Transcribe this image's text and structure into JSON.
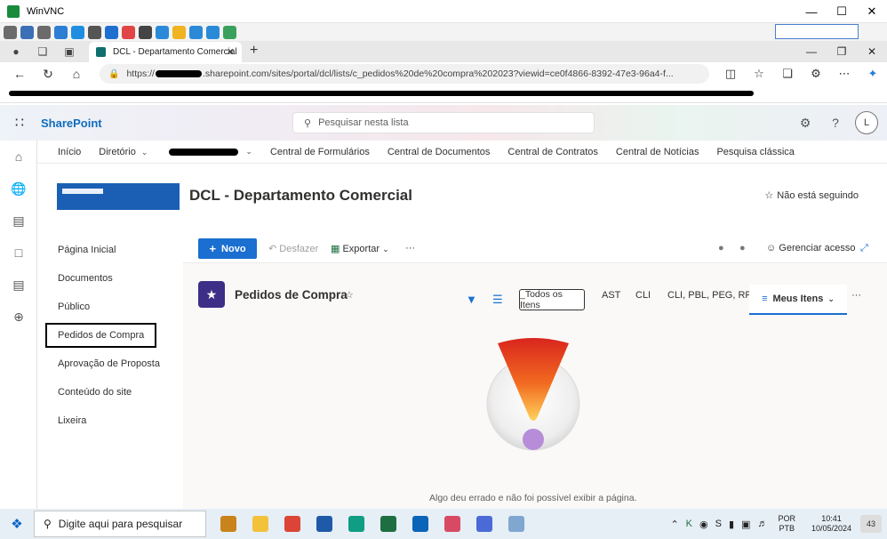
{
  "vnc": {
    "title": "WinVNC",
    "controls": [
      "—",
      "☐",
      "✕"
    ],
    "toolbar_icons": [
      {
        "name": "person-icon",
        "color": "#6b6b6b"
      },
      {
        "name": "fullscreen-icon",
        "color": "#3b6fb6"
      },
      {
        "name": "settings-icon",
        "color": "#6b6b6b"
      },
      {
        "name": "refresh-icon",
        "color": "#2d7fd3"
      },
      {
        "name": "windows-icon",
        "color": "#1f8ee0"
      },
      {
        "name": "terminal-icon",
        "color": "#555"
      },
      {
        "name": "info-icon",
        "color": "#1f6fd1"
      },
      {
        "name": "disconnect-icon",
        "color": "#e04646"
      },
      {
        "name": "file-transfer-icon",
        "color": "#444"
      },
      {
        "name": "monitor-icon",
        "color": "#2a8ad8"
      },
      {
        "name": "folder-icon",
        "color": "#f0b422"
      },
      {
        "name": "camera-icon",
        "color": "#2a8ad8"
      },
      {
        "name": "monitor-share-icon",
        "color": "#2a8ad8"
      },
      {
        "name": "chat-icon",
        "color": "#3aa05b"
      }
    ]
  },
  "browser": {
    "tab_title": "DCL - Departamento Comercial",
    "tab_close": "✕",
    "new_tab": "+",
    "url_prefix": "https://",
    "url_suffix": ".sharepoint.com/sites/portal/dcl/lists/c_pedidos%20de%20compra%202023?viewid=ce0f4866-8392-47e3-96a4-f...",
    "window_controls": [
      "—",
      "❐",
      "✕"
    ]
  },
  "sharepoint": {
    "brand": "SharePoint",
    "search_placeholder": "Pesquisar nesta lista",
    "avatar_initial": "L",
    "hub_nav": [
      "Início",
      "Diretório",
      "Central de Formulários",
      "Central de Documentos",
      "Central de Contratos",
      "Central de Notícias",
      "Pesquisa clássica"
    ],
    "site_title": "DCL - Departamento Comercial",
    "follow_label": "Não está seguindo",
    "left_nav": [
      "Página Inicial",
      "Documentos",
      "Público",
      "Pedidos de Compra",
      "Aprovação de Proposta",
      "Conteúdo do site",
      "Lixeira"
    ],
    "selected_nav": "Pedidos de Compra",
    "commands": {
      "new": "Novo",
      "undo": "Desfazer",
      "export": "Exportar",
      "more": "···",
      "manage_access": "Gerenciar acesso"
    },
    "list_title": "Pedidos de Compra",
    "views": {
      "all_items": "_Todos os Itens",
      "ast": "AST",
      "cli": "CLI",
      "cli_group": "CLI, PBL, PEG, RPE",
      "my_items": "Meus Itens",
      "more": "···"
    },
    "error_message": "Algo deu errado e não foi possível exibir a página."
  },
  "taskbar": {
    "search_placeholder": "Digite aqui para pesquisar",
    "apps": [
      {
        "name": "toolbox-icon",
        "color": "#c8831a"
      },
      {
        "name": "file-explorer-icon",
        "color": "#f2c23a"
      },
      {
        "name": "chrome-icon",
        "color": "#db4437"
      },
      {
        "name": "app-window-icon",
        "color": "#1e5aa8"
      },
      {
        "name": "edge-icon",
        "color": "#0f9d83"
      },
      {
        "name": "excel-icon",
        "color": "#1d6f42"
      },
      {
        "name": "outlook-icon",
        "color": "#0a64b8"
      },
      {
        "name": "snipping-tool-icon",
        "color": "#d84a64"
      },
      {
        "name": "chat-app-icon",
        "color": "#4a6bd6"
      },
      {
        "name": "vnc-app-icon",
        "color": "#7fa7cf"
      }
    ],
    "lang_line1": "POR",
    "lang_line2": "PTB",
    "time": "10:41",
    "date": "10/05/2024",
    "notification_count": "43"
  }
}
